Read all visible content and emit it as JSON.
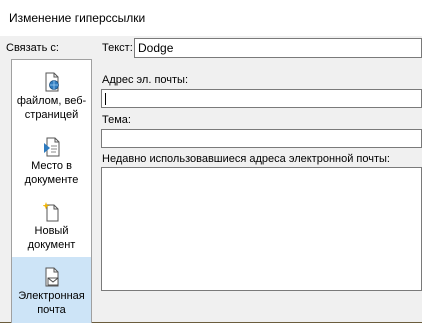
{
  "dialog": {
    "title": "Изменение гиперссылки"
  },
  "sidebar": {
    "heading": "Связать с:",
    "items": [
      {
        "line1": "файлом, веб-",
        "line2": "страницей",
        "icon": "web-page-icon",
        "active": false
      },
      {
        "line1": "Место в",
        "line2": "документе",
        "icon": "document-place-icon",
        "active": false
      },
      {
        "line1": "Новый",
        "line2": "документ",
        "icon": "new-document-icon",
        "active": false
      },
      {
        "line1": "Электронная",
        "line2": "почта",
        "icon": "email-icon",
        "active": true
      }
    ]
  },
  "form": {
    "text_label": "Текст:",
    "text_value": "Dodge",
    "email_label": "Адрес эл. почты:",
    "email_value": "",
    "subject_label": "Тема:",
    "subject_value": "",
    "recent_label": "Недавно использовавшиеся адреса электронной почты:"
  }
}
